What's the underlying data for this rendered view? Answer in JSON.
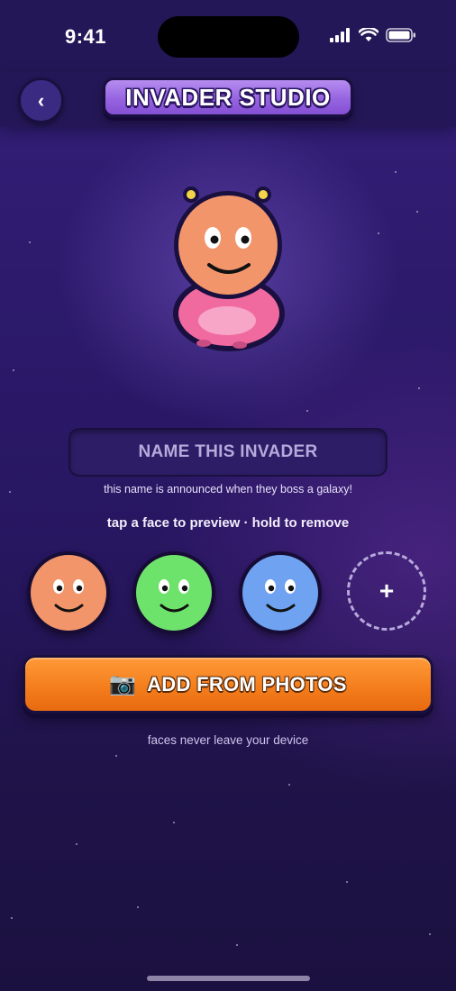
{
  "status_bar": {
    "time": "9:41",
    "icons": [
      "cellular-signal-icon",
      "wifi-icon",
      "battery-icon"
    ]
  },
  "header": {
    "back_icon": "chevron-left-icon",
    "back_glyph": "‹",
    "title": "INVADER STUDIO"
  },
  "invader": {
    "head_color": "#f2956b",
    "body_color": "#f06aa0",
    "antenna_color": "#f5d44a"
  },
  "name_field": {
    "placeholder": "NAME THIS INVADER",
    "value": ""
  },
  "name_hint": "this name is announced when they boss a galaxy!",
  "faces_hint": "tap a face to preview · hold to remove",
  "faces": [
    {
      "name": "orange-face",
      "color": "#f2956b"
    },
    {
      "name": "green-face",
      "color": "#6ee36c"
    },
    {
      "name": "blue-face",
      "color": "#6fa2f0"
    }
  ],
  "add_face_glyph": "+",
  "photos_button": {
    "icon": "camera-icon",
    "icon_glyph": "📷",
    "label": "ADD FROM PHOTOS"
  },
  "privacy_note": "faces never leave your device",
  "colors": {
    "accent_purple": "#9461df",
    "accent_orange": "#f47e1c",
    "background": "#271660"
  }
}
